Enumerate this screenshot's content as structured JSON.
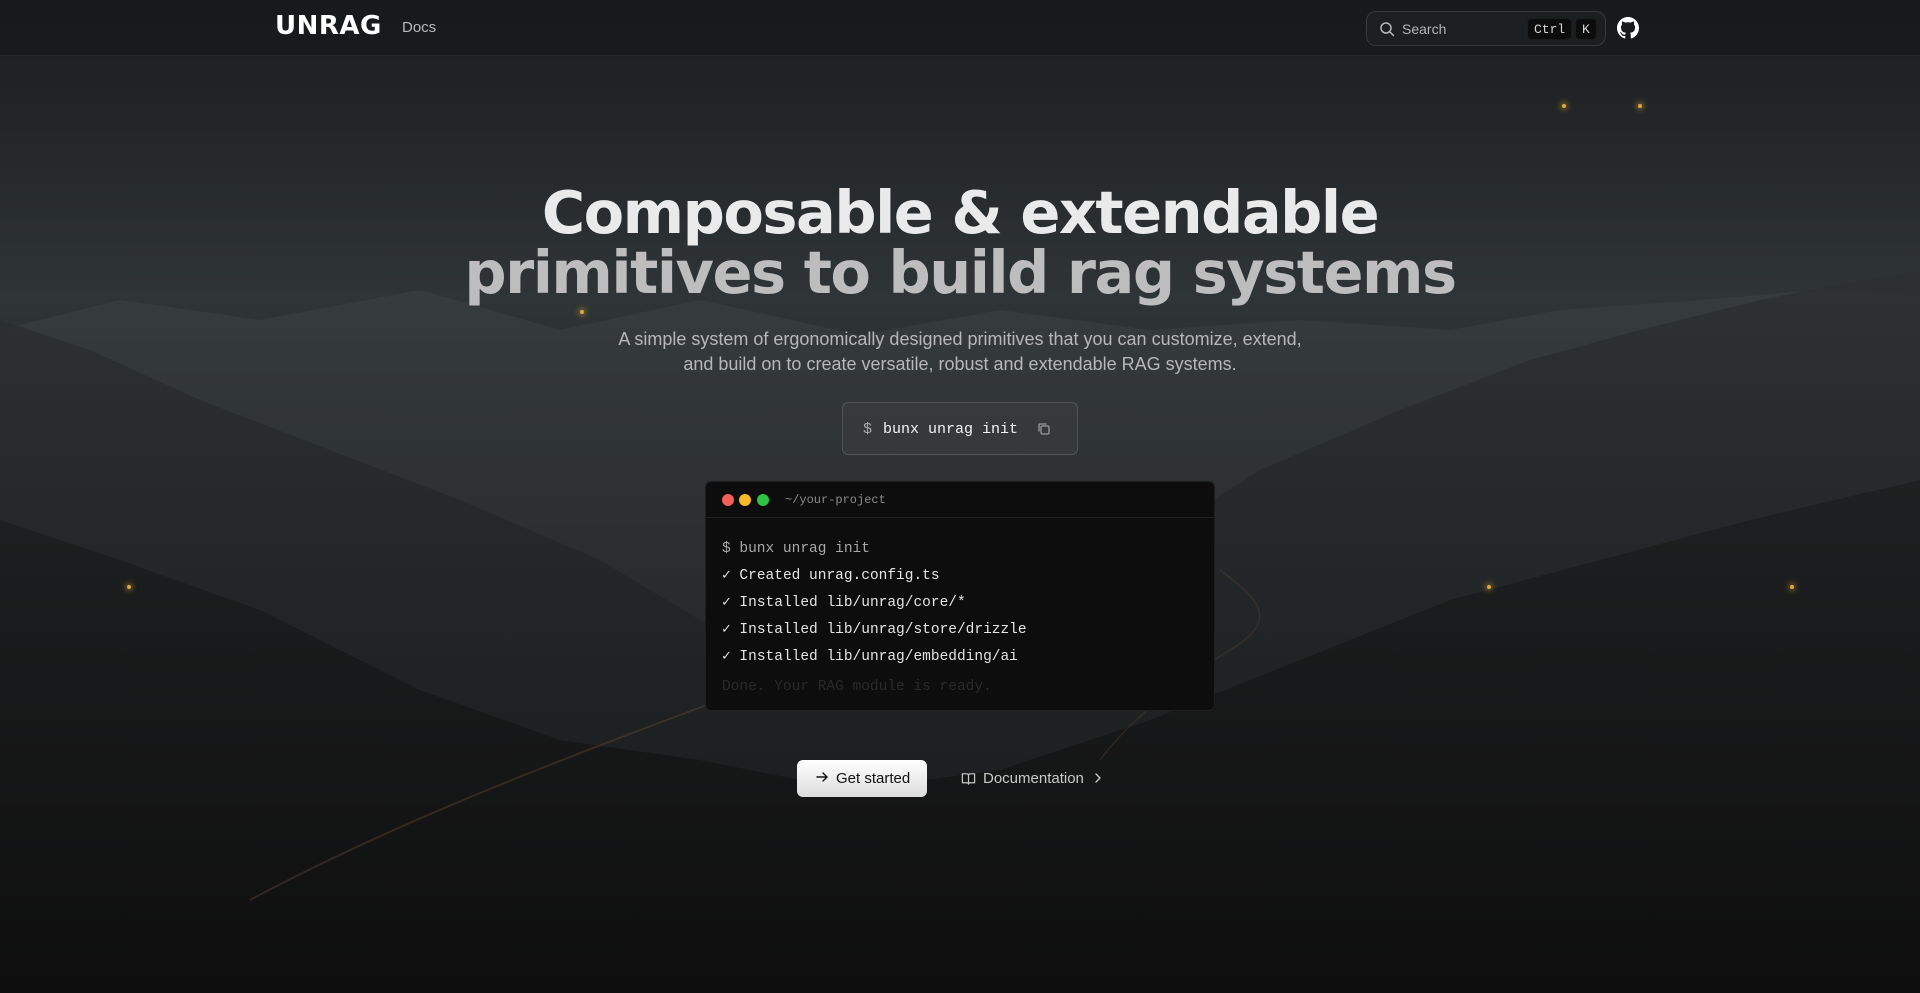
{
  "nav": {
    "logo": "UNRAG",
    "docs_link": "Docs",
    "search": {
      "label": "Search",
      "shortcut_modifier": "Ctrl",
      "shortcut_key": "K"
    },
    "github_icon": "github-icon"
  },
  "hero": {
    "title_line1": "Composable & extendable",
    "title_line2": "primitives to build rag systems",
    "subtitle": "A simple system of ergonomically designed primitives that you can customize, extend, and build on to create versatile, robust and extendable RAG systems."
  },
  "install": {
    "prompt": "$",
    "command": "bunx unrag init",
    "copy_icon": "copy-icon"
  },
  "terminal": {
    "path": "~/your-project",
    "lines": [
      "$ bunx unrag init",
      "✓ Created unrag.config.ts",
      "✓ Installed lib/unrag/core/*",
      "✓ Installed lib/unrag/store/drizzle",
      "✓ Installed lib/unrag/embedding/ai",
      "Done. Your RAG module is ready."
    ]
  },
  "cta": {
    "primary": "Get started",
    "secondary": "Documentation"
  },
  "colors": {
    "background": "#151617",
    "accent_star": "#e0a83a",
    "terminal_bg": "#0d0d0d"
  }
}
